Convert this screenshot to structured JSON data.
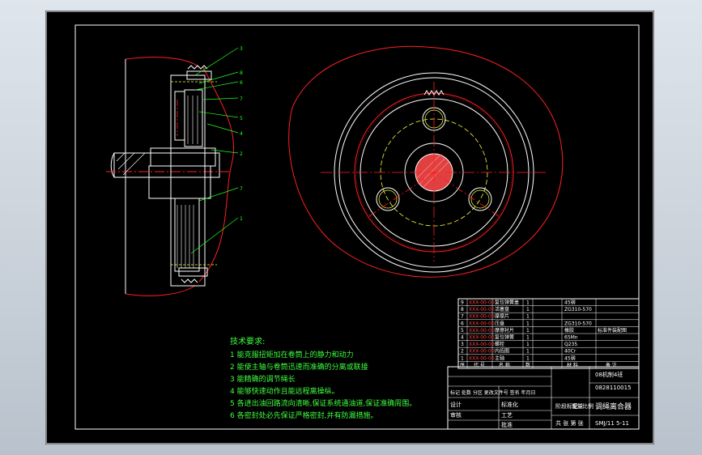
{
  "drawing": {
    "leader_numbers": [
      "3",
      "8",
      "6",
      "7",
      "5",
      "4",
      "2",
      "7",
      "1"
    ],
    "tech": {
      "title": "技术要求:",
      "items": [
        "1 能克服扭矩加在卷筒上的静力和动力",
        "2 能使主轴与卷筒迅速而准确的分离或联接",
        "3 能精确的调节绳长",
        "4 能够快速动作且能远程离操纵。",
        "5 各进出油回路流向清晰,保证系统通油道,保证准确周围。",
        "6 各密封处必先保证严格密封,并有防漏措施。"
      ]
    },
    "parts_list": {
      "rows": [
        {
          "no": "9",
          "code": "XXX-00-00",
          "name": "复位弹簧盖",
          "qty": "1",
          "material": "45钢",
          "note": ""
        },
        {
          "no": "8",
          "code": "XXX-00-00",
          "name": "活塞盘",
          "qty": "1",
          "material": "ZG310-570",
          "note": ""
        },
        {
          "no": "7",
          "code": "XXX-00-00",
          "name": "摩擦片",
          "qty": "1",
          "material": "",
          "note": ""
        },
        {
          "no": "6",
          "code": "XXX-00-00",
          "name": "压盘",
          "qty": "1",
          "material": "ZG310-570",
          "note": ""
        },
        {
          "no": "5",
          "code": "XXX-00-00",
          "name": "摩擦衬片",
          "qty": "1",
          "material": "橡胶",
          "note": "标准件装配图"
        },
        {
          "no": "4",
          "code": "XXX-00-00",
          "name": "复位弹簧",
          "qty": "1",
          "material": "65Mn",
          "note": ""
        },
        {
          "no": "3",
          "code": "XXX-00-00",
          "name": "螺栓",
          "qty": "1",
          "material": "Q235",
          "note": ""
        },
        {
          "no": "2",
          "code": "XXX-00-00",
          "name": "内齿圈",
          "qty": "1",
          "material": "40Cr",
          "note": ""
        },
        {
          "no": "1",
          "code": "XXX-00-00",
          "name": "主轴",
          "qty": "1",
          "material": "45钢",
          "note": ""
        }
      ],
      "header": [
        "序",
        "代 号",
        "名 称",
        "数",
        "材 料",
        "备 注"
      ]
    },
    "title_block": {
      "school": "08机制4班",
      "student_no": "0828110015",
      "drawing_name": "调绳离合器",
      "drawing_no": "SMJ/11 5-11",
      "stage_labels": [
        "阶段标记",
        "重量",
        "比例"
      ],
      "sheet": "共 张  第 张",
      "mark": "标记 处数 分区 更改文件号 签名 年月日",
      "design": "设计",
      "standard": "标准化",
      "check": "审核",
      "process": "工艺",
      "approve": "批准"
    }
  },
  "colors": {
    "background": "#000000",
    "frame": "#ffffff",
    "contour": "#ff2020",
    "centerline": "#ff2020",
    "hidden": "#ffff40",
    "leader": "#20ff20",
    "text_green": "#40ff40",
    "hatch": "#ff3030"
  }
}
